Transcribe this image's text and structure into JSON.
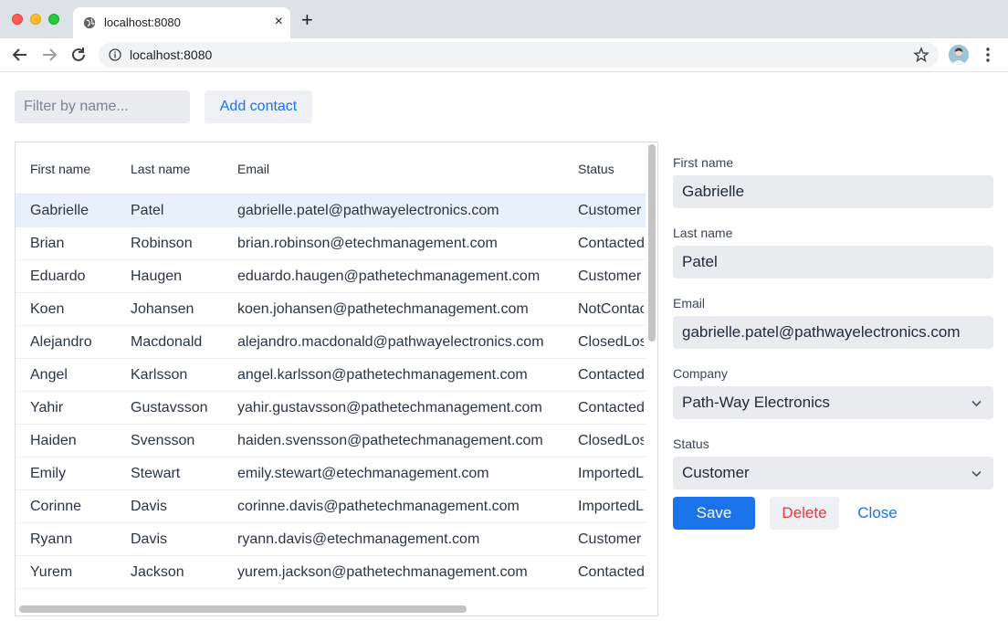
{
  "browser": {
    "tab_title": "localhost:8080",
    "url": "localhost:8080",
    "new_tab_symbol": "+",
    "close_symbol": "×"
  },
  "toolbar": {
    "filter_placeholder": "Filter by name...",
    "add_contact_label": "Add contact"
  },
  "grid": {
    "columns": [
      "First name",
      "Last name",
      "Email",
      "Status"
    ],
    "rows": [
      {
        "first": "Gabrielle",
        "last": "Patel",
        "email": "gabrielle.patel@pathwayelectronics.com",
        "status": "Customer"
      },
      {
        "first": "Brian",
        "last": "Robinson",
        "email": "brian.robinson@etechmanagement.com",
        "status": "Contacted"
      },
      {
        "first": "Eduardo",
        "last": "Haugen",
        "email": "eduardo.haugen@pathetechmanagement.com",
        "status": "Customer"
      },
      {
        "first": "Koen",
        "last": "Johansen",
        "email": "koen.johansen@pathetechmanagement.com",
        "status": "NotContacted"
      },
      {
        "first": "Alejandro",
        "last": "Macdonald",
        "email": "alejandro.macdonald@pathwayelectronics.com",
        "status": "ClosedLost"
      },
      {
        "first": "Angel",
        "last": "Karlsson",
        "email": "angel.karlsson@pathetechmanagement.com",
        "status": "Contacted"
      },
      {
        "first": "Yahir",
        "last": "Gustavsson",
        "email": "yahir.gustavsson@pathetechmanagement.com",
        "status": "Contacted"
      },
      {
        "first": "Haiden",
        "last": "Svensson",
        "email": "haiden.svensson@pathetechmanagement.com",
        "status": "ClosedLost"
      },
      {
        "first": "Emily",
        "last": "Stewart",
        "email": "emily.stewart@etechmanagement.com",
        "status": "ImportedLead"
      },
      {
        "first": "Corinne",
        "last": "Davis",
        "email": "corinne.davis@pathetechmanagement.com",
        "status": "ImportedLead"
      },
      {
        "first": "Ryann",
        "last": "Davis",
        "email": "ryann.davis@etechmanagement.com",
        "status": "Customer"
      },
      {
        "first": "Yurem",
        "last": "Jackson",
        "email": "yurem.jackson@pathetechmanagement.com",
        "status": "Contacted"
      }
    ],
    "selected_index": 0
  },
  "form": {
    "first_name_label": "First name",
    "first_name_value": "Gabrielle",
    "last_name_label": "Last name",
    "last_name_value": "Patel",
    "email_label": "Email",
    "email_value": "gabrielle.patel@pathwayelectronics.com",
    "company_label": "Company",
    "company_value": "Path-Way Electronics",
    "status_label": "Status",
    "status_value": "Customer",
    "save_label": "Save",
    "delete_label": "Delete",
    "close_label": "Close"
  },
  "colors": {
    "accent": "#1a73e8",
    "danger": "#e5383b",
    "selected_row": "#e8f0fc"
  }
}
